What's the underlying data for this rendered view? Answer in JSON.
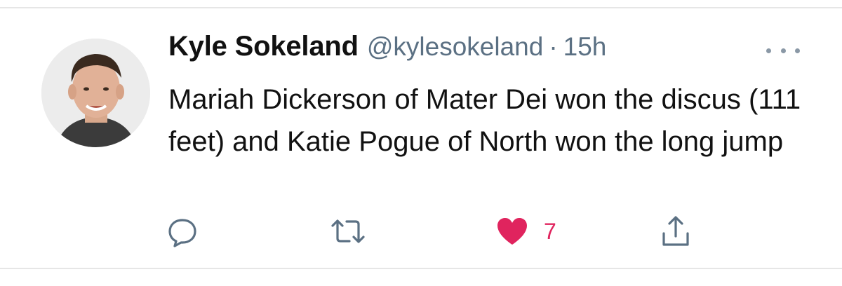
{
  "tweet": {
    "author_name": "Kyle Sokeland",
    "handle": "@kylesokeland",
    "separator": "·",
    "time": "15h",
    "text": "Mariah Dickerson of Mater Dei won the discus (111 feet) and Katie Pogue of North won the long jump",
    "actions": {
      "reply_icon": "reply-bubble-icon",
      "retweet_icon": "retweet-icon",
      "like_icon": "heart-filled-icon",
      "like_count": "7",
      "share_icon": "share-icon"
    },
    "colors": {
      "handle": "#5b7083",
      "text": "#111111",
      "icon": "#5b7083",
      "like": "#e0245e"
    }
  }
}
